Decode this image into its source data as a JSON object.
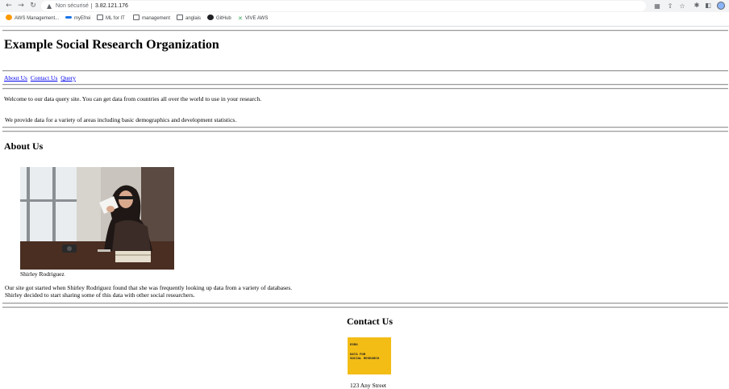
{
  "browser": {
    "security_label": "Non sécurisé",
    "url": "3.82.121.176",
    "bookmarks": [
      "AWS Management...",
      "myEfrei",
      "ML for IT",
      "management",
      "anglais",
      "GitHub",
      "VIVE AWS"
    ]
  },
  "page": {
    "title": "Example Social Research Organization",
    "nav_links": [
      "About Us",
      "Contact Us",
      "Query"
    ],
    "intro": [
      "Welcome to our data query site. You can get data from countries all over the world to use in your research.",
      "We provide data for a variety of areas including basic demographics and development statistics."
    ],
    "about": {
      "heading": "About Us",
      "photo_caption": "Shirley Rodriguez",
      "text_lines": [
        "Our site got started when Shirley Rodriguez found that she was frequently looking up data from a variety of databases.",
        "Shirley decided to start sharing some of this data with other social researchers."
      ]
    },
    "contact": {
      "heading": "Contact Us",
      "logo_line1": "ESRO",
      "logo_line2": "DATA FOR",
      "logo_line3": "SOCIAL RESEARCH",
      "address": "123 Any Street"
    }
  }
}
